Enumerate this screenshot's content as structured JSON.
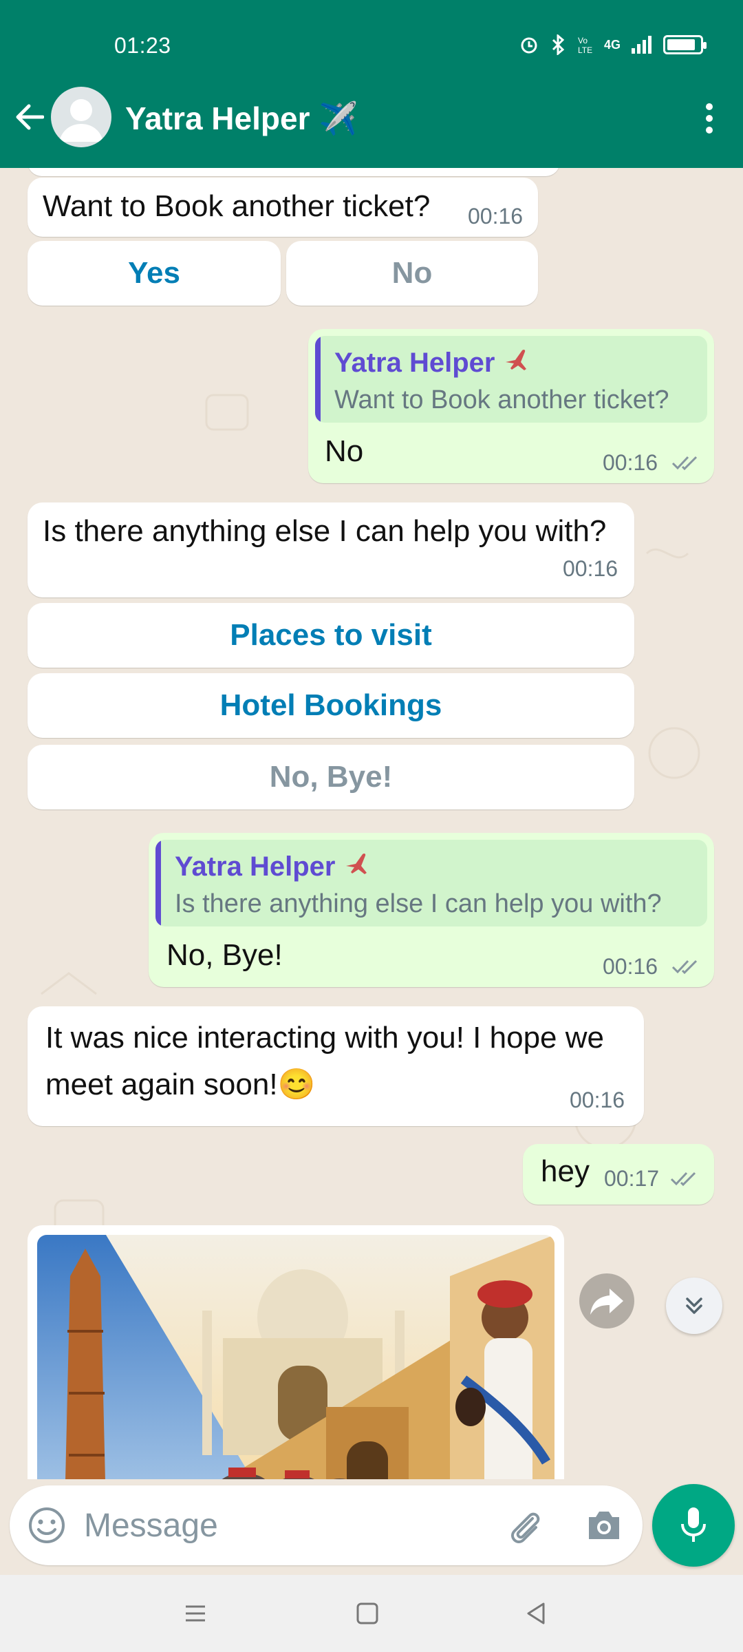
{
  "status_bar": {
    "time": "01:23",
    "network": "4G"
  },
  "header": {
    "title": "Yatra Helper ✈️"
  },
  "colors": {
    "header": "#008069",
    "outgoing_bubble": "#e7ffdb",
    "button_text": "#027eb5",
    "quote_accent": "#5f4bd2",
    "mic_button": "#00a884"
  },
  "messages": [
    {
      "dir": "in",
      "text": "Want to Book another ticket?",
      "time": "00:16"
    },
    {
      "dir": "out",
      "quote_title": "Yatra Helper",
      "quote_text": "Want to Book another ticket?",
      "text": "No",
      "time": "00:16",
      "status": "read"
    },
    {
      "dir": "in",
      "text": "Is there anything else I can help you with?",
      "time": "00:16"
    },
    {
      "dir": "out",
      "quote_title": "Yatra Helper",
      "quote_text": "Is there anything else I can help you with?",
      "text": "No, Bye!",
      "time": "00:16",
      "status": "read"
    },
    {
      "dir": "in",
      "text_line1": "It was nice interacting with you! I hope we",
      "text_line2": "meet again soon!😊",
      "time": "00:16"
    },
    {
      "dir": "out",
      "text": "hey",
      "time": "00:17",
      "status": "read"
    }
  ],
  "quick_replies_1": {
    "yes": "Yes",
    "no": "No"
  },
  "quick_replies_2": {
    "places": "Places to visit",
    "hotels": "Hotel Bookings",
    "bye": "No, Bye!"
  },
  "input": {
    "placeholder": "Message"
  },
  "icons": [
    "back-arrow-icon",
    "avatar-icon",
    "more-icon",
    "double-check-icon",
    "forward-icon",
    "chevron-double-down-icon",
    "emoji-icon",
    "attach-icon",
    "camera-icon",
    "mic-icon",
    "menu-nav-icon",
    "home-nav-icon",
    "back-nav-icon"
  ]
}
